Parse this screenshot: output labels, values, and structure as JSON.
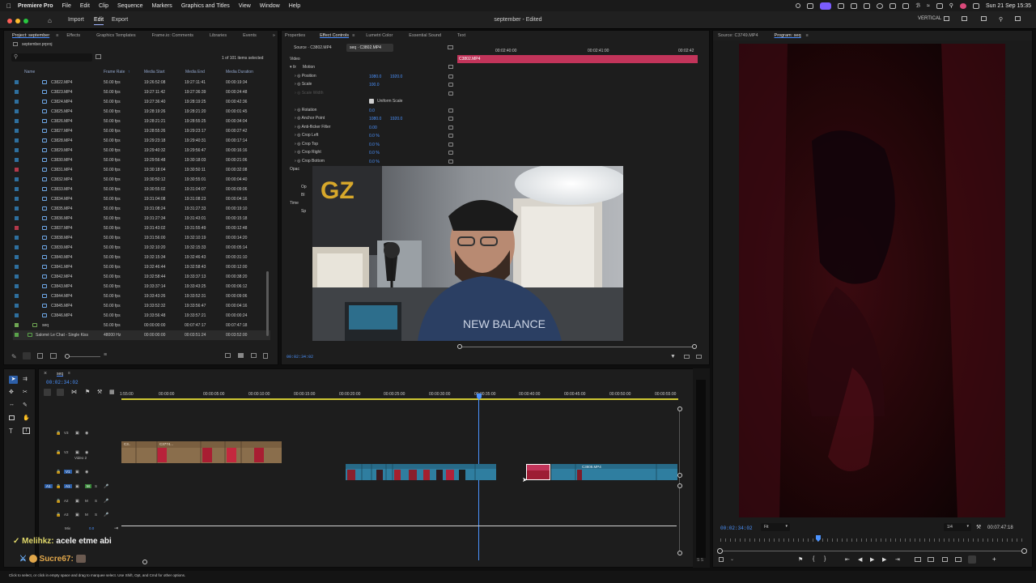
{
  "menubar": {
    "app": "Premiere Pro",
    "items": [
      "File",
      "Edit",
      "Clip",
      "Sequence",
      "Markers",
      "Graphics and Titles",
      "View",
      "Window",
      "Help"
    ],
    "clock": "Sun 21 Sep 15:35"
  },
  "titlebar": {
    "tabs": [
      "Import",
      "Edit",
      "Export"
    ],
    "selected_tab": "Edit",
    "doc_title": "september - Edited",
    "workspace": "VERTICAL"
  },
  "project_panel": {
    "tabs": [
      "Project: september",
      "Effects",
      "Graphics Templates",
      "Frame.io: Comments",
      "Libraries",
      "Events"
    ],
    "project_file": "september.prproj",
    "items_selected": "1 of 101 items selected",
    "columns": [
      "Name",
      "Frame Rate",
      "Media Start",
      "Media End",
      "Media Duration"
    ],
    "rows": [
      {
        "name": "C3822.MP4",
        "fps": "50.00 fps",
        "start": "19:26:52:08",
        "end": "19:27:11:41",
        "dur": "00:00:19:34",
        "color": "#2e6f9e"
      },
      {
        "name": "C3823.MP4",
        "fps": "50.00 fps",
        "start": "19:27:11:42",
        "end": "19:27:36:39",
        "dur": "00:00:24:48",
        "color": "#2e6f9e"
      },
      {
        "name": "C3824.MP4",
        "fps": "50.00 fps",
        "start": "19:27:36:40",
        "end": "19:28:19:25",
        "dur": "00:00:42:36",
        "color": "#2e6f9e"
      },
      {
        "name": "C3825.MP4",
        "fps": "50.00 fps",
        "start": "19:28:19:26",
        "end": "19:28:21:20",
        "dur": "00:00:01:45",
        "color": "#2e6f9e"
      },
      {
        "name": "C3826.MP4",
        "fps": "50.00 fps",
        "start": "19:28:21:21",
        "end": "19:28:55:25",
        "dur": "00:00:34:04",
        "color": "#2e6f9e"
      },
      {
        "name": "C3827.MP4",
        "fps": "50.00 fps",
        "start": "19:28:55:26",
        "end": "19:29:23:17",
        "dur": "00:00:27:42",
        "color": "#2e6f9e"
      },
      {
        "name": "C3828.MP4",
        "fps": "50.00 fps",
        "start": "19:29:23:18",
        "end": "19:29:40:31",
        "dur": "00:00:17:14",
        "color": "#2e6f9e"
      },
      {
        "name": "C3829.MP4",
        "fps": "50.00 fps",
        "start": "19:29:40:32",
        "end": "19:29:56:47",
        "dur": "00:00:16:16",
        "color": "#2e6f9e"
      },
      {
        "name": "C3830.MP4",
        "fps": "50.00 fps",
        "start": "19:29:56:48",
        "end": "19:30:18:03",
        "dur": "00:00:21:06",
        "color": "#2e6f9e"
      },
      {
        "name": "C3831.MP4",
        "fps": "50.00 fps",
        "start": "19:30:18:04",
        "end": "19:30:50:11",
        "dur": "00:00:32:08",
        "color": "#b3384a"
      },
      {
        "name": "C3832.MP4",
        "fps": "50.00 fps",
        "start": "19:30:50:12",
        "end": "19:30:55:01",
        "dur": "00:00:04:40",
        "color": "#2e6f9e"
      },
      {
        "name": "C3833.MP4",
        "fps": "50.00 fps",
        "start": "19:30:55:02",
        "end": "19:31:04:07",
        "dur": "00:00:09:06",
        "color": "#2e6f9e"
      },
      {
        "name": "C3834.MP4",
        "fps": "50.00 fps",
        "start": "19:31:04:08",
        "end": "19:31:08:23",
        "dur": "00:00:04:16",
        "color": "#2e6f9e"
      },
      {
        "name": "C3835.MP4",
        "fps": "50.00 fps",
        "start": "19:31:08:24",
        "end": "19:31:27:33",
        "dur": "00:00:19:10",
        "color": "#2e6f9e"
      },
      {
        "name": "C3836.MP4",
        "fps": "50.00 fps",
        "start": "19:31:27:34",
        "end": "19:31:43:01",
        "dur": "00:00:15:18",
        "color": "#2e6f9e"
      },
      {
        "name": "C3837.MP4",
        "fps": "50.00 fps",
        "start": "19:31:43:02",
        "end": "19:31:55:49",
        "dur": "00:00:12:48",
        "color": "#b3384a"
      },
      {
        "name": "C3838.MP4",
        "fps": "50.00 fps",
        "start": "19:31:56:00",
        "end": "19:32:10:19",
        "dur": "00:00:14:20",
        "color": "#2e6f9e"
      },
      {
        "name": "C3839.MP4",
        "fps": "50.00 fps",
        "start": "19:32:10:20",
        "end": "19:32:15:33",
        "dur": "00:00:05:14",
        "color": "#2e6f9e"
      },
      {
        "name": "C3840.MP4",
        "fps": "50.00 fps",
        "start": "19:32:15:34",
        "end": "19:32:46:43",
        "dur": "00:00:31:10",
        "color": "#2e6f9e"
      },
      {
        "name": "C3841.MP4",
        "fps": "50.00 fps",
        "start": "19:32:46:44",
        "end": "19:32:58:43",
        "dur": "00:00:12:00",
        "color": "#2e6f9e"
      },
      {
        "name": "C3842.MP4",
        "fps": "50.00 fps",
        "start": "19:32:58:44",
        "end": "19:33:37:13",
        "dur": "00:00:38:20",
        "color": "#2e6f9e"
      },
      {
        "name": "C3843.MP4",
        "fps": "50.00 fps",
        "start": "19:33:37:14",
        "end": "19:33:43:25",
        "dur": "00:00:06:12",
        "color": "#2e6f9e"
      },
      {
        "name": "C3844.MP4",
        "fps": "50.00 fps",
        "start": "19:33:43:26",
        "end": "19:33:52:31",
        "dur": "00:00:09:06",
        "color": "#2e6f9e"
      },
      {
        "name": "C3845.MP4",
        "fps": "50.00 fps",
        "start": "19:33:52:32",
        "end": "19:33:56:47",
        "dur": "00:00:04:16",
        "color": "#2e6f9e"
      },
      {
        "name": "C3846.MP4",
        "fps": "50.00 fps",
        "start": "19:33:56:48",
        "end": "19:33:57:21",
        "dur": "00:00:00:24",
        "color": "#2e6f9e"
      }
    ],
    "seq_row": {
      "name": "seq",
      "fps": "50.00 fps",
      "start": "00:00:00:00",
      "end": "00:07:47:17",
      "dur": "00:07:47:18"
    },
    "audio_row": {
      "name": "Salomé Le Chat - Single Kiss",
      "fps": "48000 Hz",
      "start": "00:00:00:00",
      "end": "00:03:51:24",
      "dur": "00:03:52:00"
    }
  },
  "effect_controls": {
    "tabs": [
      "Properties",
      "Effect Controls",
      "Lumetri Color",
      "Essential Sound",
      "Text"
    ],
    "source_label": "Source · C3802.MP4",
    "seq_label": "seq · C3802.MP4",
    "clip_label": "C3802.MP4",
    "ruler": [
      "00:02:40:00",
      "00:02:41:00",
      "00:02:42"
    ],
    "section_video": "Video",
    "section_motion": "Motion",
    "uniform_scale": "Uniform Scale",
    "rows": [
      {
        "label": "Position",
        "v1": "1080.0",
        "v2": "1920.0"
      },
      {
        "label": "Scale",
        "v1": "100.0",
        "v2": ""
      },
      {
        "label": "Scale Width",
        "v1": "",
        "v2": ""
      },
      {
        "label": "Rotation",
        "v1": "0.0",
        "v2": ""
      },
      {
        "label": "Anchor Point",
        "v1": "1080.0",
        "v2": "1920.0"
      },
      {
        "label": "Anti-flicker Filter",
        "v1": "0.00",
        "v2": ""
      },
      {
        "label": "Crop Left",
        "v1": "0.0 %",
        "v2": ""
      },
      {
        "label": "Crop Top",
        "v1": "0.0 %",
        "v2": ""
      },
      {
        "label": "Crop Right",
        "v1": "0.0 %",
        "v2": ""
      },
      {
        "label": "Crop Bottom",
        "v1": "0.0 %",
        "v2": ""
      }
    ],
    "partial_rows": [
      "Opac",
      "Op",
      "Bl",
      "Time",
      "Sp"
    ],
    "timecode": "00:02:34:02"
  },
  "program_monitor": {
    "source_tab": "Source: C3749.MP4",
    "program_tab": "Program: seq",
    "timecode": "00:02:34:02",
    "fit": "Fit",
    "resolution": "1/4",
    "duration": "00:07:47:18"
  },
  "timeline": {
    "seq_tab": "seq",
    "timecode": "00:02:34:02",
    "ruler": [
      "1:55:00",
      "00:00:00",
      "00:00:05:00",
      "00:00:10:00",
      "00:00:15:00",
      "00:00:20:00",
      "00:00:25:00",
      "00:00:30:00",
      "00:00:35:00",
      "00:00:40:00",
      "00:00:45:00",
      "00:00:50:00",
      "00:00:55:00"
    ],
    "video_tracks": [
      "V3",
      "V2",
      "V1"
    ],
    "v2_name": "Video 2",
    "audio_tracks": [
      "A1",
      "A2",
      "A3"
    ],
    "mix_label": "Mix",
    "mix_value": "0.0",
    "v2_clip_labels": [
      "C3..",
      "C3774..."
    ],
    "v1_clip_label": "C3808.MP4",
    "m_label": "M",
    "s_label": "S"
  },
  "chat": [
    {
      "user": "Melihkz:",
      "msg": "acele etme abi"
    },
    {
      "user": "Sucre67:",
      "msg": ""
    }
  ],
  "status_hint": "Click to select, or click in empty space and drag to marquee select. Use Shift, Opt, and Cmd for other options.",
  "colors": {
    "accent": "#4b93ff",
    "clip_pink": "#c2345a",
    "clip_blue": "#2f7ea0",
    "clip_tan": "#8a6e4c"
  }
}
